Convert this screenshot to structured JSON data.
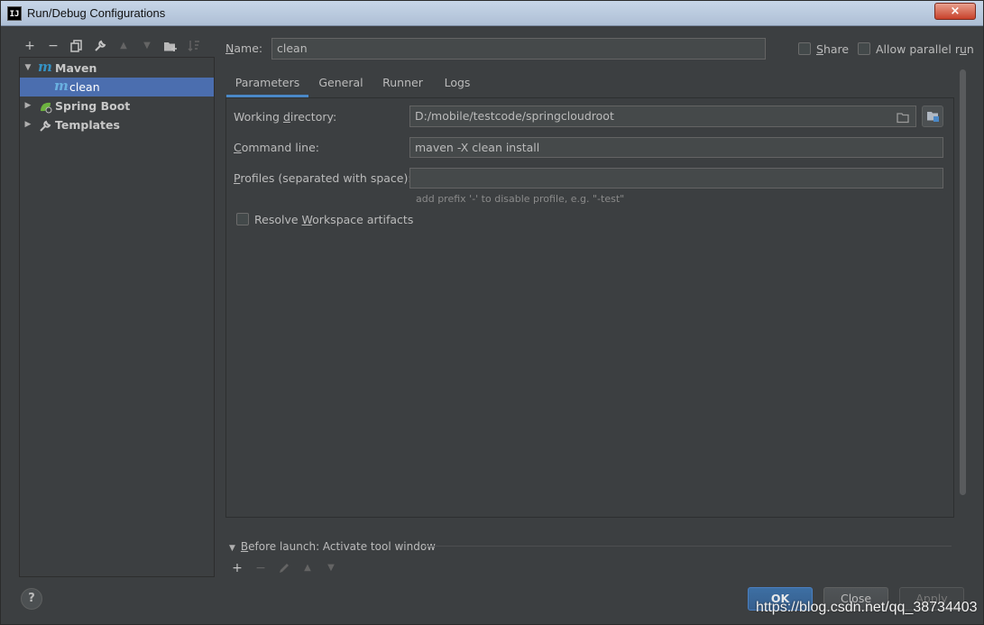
{
  "window": {
    "title": "Run/Debug Configurations",
    "app_icon": "IJ",
    "close_symbol": "×"
  },
  "toolbar": {
    "add": "+",
    "remove": "−",
    "copy_icon": "copy-icon",
    "edit_icon": "wrench-icon",
    "up": "▲",
    "down": "▼",
    "folder_icon": "new-folder-icon",
    "sort_icon": "sort-icon"
  },
  "tree": {
    "items": [
      {
        "label": "Maven",
        "icon": "maven-icon",
        "expanded": true
      },
      {
        "label": "clean",
        "icon": "maven-icon",
        "selected": true
      },
      {
        "label": "Spring Boot",
        "icon": "spring-boot-icon",
        "expanded": false
      },
      {
        "label": "Templates",
        "icon": "wrench-icon",
        "expanded": false
      }
    ]
  },
  "name": {
    "label_underlined": "N",
    "label_rest": "ame:",
    "value": "clean"
  },
  "share": {
    "label_pre": "",
    "label_underlined": "S",
    "label_rest": "hare",
    "checked": false
  },
  "parallel": {
    "label_pre": "Allow parallel r",
    "label_underlined": "u",
    "label_rest": "n",
    "checked": false
  },
  "tabs": [
    {
      "label": "Parameters",
      "active": true
    },
    {
      "label": "General",
      "active": false
    },
    {
      "label": "Runner",
      "active": false
    },
    {
      "label": "Logs",
      "active": false
    }
  ],
  "params": {
    "working_dir": {
      "label_pre": "Working ",
      "label_underlined": "d",
      "label_rest": "irectory:",
      "value": "D:/mobile/testcode/springcloudroot"
    },
    "command_line": {
      "label_underlined": "C",
      "label_rest": "ommand line:",
      "value": "maven -X clean install"
    },
    "profiles": {
      "label_underlined": "P",
      "label_rest": "rofiles (separated with space):",
      "value": "",
      "hint": "add prefix '-' to disable profile, e.g. \"-test\""
    },
    "resolve": {
      "label_pre": "Resolve ",
      "label_underlined": "W",
      "label_rest": "orkspace artifacts",
      "checked": false
    }
  },
  "before_launch": {
    "label_underlined": "B",
    "label_rest": "efore launch: Activate tool window"
  },
  "bl_toolbar": {
    "add": "+",
    "remove": "−",
    "edit_icon": "pencil-icon",
    "up": "▲",
    "down": "▼"
  },
  "buttons": {
    "help": "?",
    "ok": "OK",
    "close": "Close",
    "apply": "Apply"
  },
  "watermark": "https://blog.csdn.net/qq_38734403",
  "colors": {
    "background": "#3c3f41",
    "selection": "#4b6eaf",
    "accent": "#4a88c7",
    "maven": "#3592c4",
    "spring": "#6db33f"
  }
}
